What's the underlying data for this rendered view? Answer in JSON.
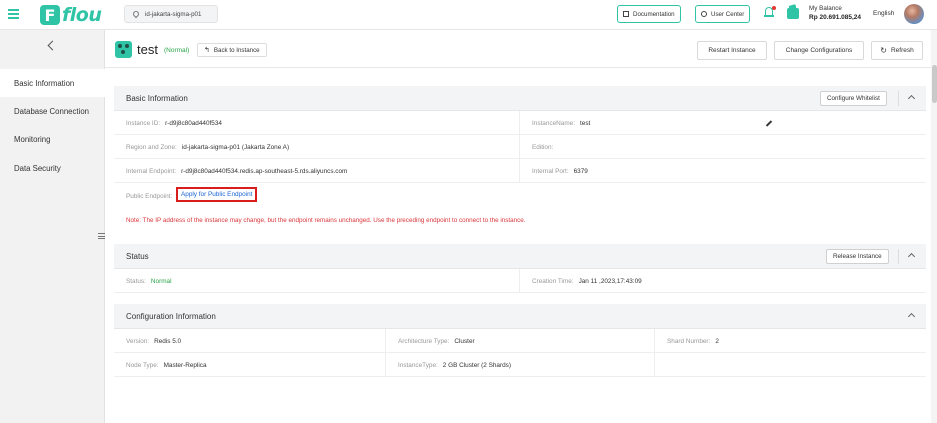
{
  "header": {
    "logo_text": "flou",
    "logo_mark": "F",
    "region": "id-jakarta-sigma-p01",
    "documentation": "Documentation",
    "user_center": "User Center",
    "balance_label": "My Balance",
    "balance_amount": "Rp 20.691.085,24",
    "language": "English",
    "brand_color": "#2ec4a5"
  },
  "sidebar": {
    "items": [
      {
        "label": "Basic Information",
        "active": true
      },
      {
        "label": "Database Connection",
        "active": false
      },
      {
        "label": "Monitoring",
        "active": false
      },
      {
        "label": "Data Security",
        "active": false
      }
    ]
  },
  "instance": {
    "name": "test",
    "status": "(Normal)",
    "back_label": "Back to Instance",
    "restart": "Restart Instance",
    "change_config": "Change Configurations",
    "refresh": "Refresh"
  },
  "basic": {
    "title": "Basic Information",
    "configure_whitelist": "Configure Whitelist",
    "instance_id_label": "Instance ID:",
    "instance_id": "r-d9j8c80ad440f534",
    "instance_name_label": "InstanceName:",
    "instance_name": "test",
    "region_zone_label": "Region and Zone:",
    "region_zone": "id-jakarta-sigma-p01 (Jakarta Zone A)",
    "edition_label": "Edition:",
    "edition": "",
    "internal_endpoint_label": "Internal Endpoint:",
    "internal_endpoint": "r-d9j8c80ad440f534.redis.ap-southeast-5.rds.aliyuncs.com",
    "internal_port_label": "Internal Port:",
    "internal_port": "6379",
    "public_endpoint_label": "Public Endpoint:",
    "public_endpoint_link": "Apply for Public Endpoint",
    "note": "Note:  The IP address of the instance may change, but the endpoint remains unchanged. Use the preceding endpoint to connect to the instance."
  },
  "status": {
    "title": "Status",
    "release": "Release Instance",
    "status_label": "Status:",
    "status_value": "Normal",
    "creation_label": "Creation Time:",
    "creation_value": "Jan 11 ,2023,17:43:09"
  },
  "config": {
    "title": "Configuration Information",
    "version_label": "Version:",
    "version": "Redis 5.0",
    "arch_label": "Architecture Type:",
    "arch": "Cluster",
    "shard_label": "Shard Number:",
    "shard": "2",
    "node_label": "Node Type:",
    "node": "Master-Replica",
    "type_label": "InstanceType:",
    "type": "2 GB Cluster (2 Shards)"
  }
}
